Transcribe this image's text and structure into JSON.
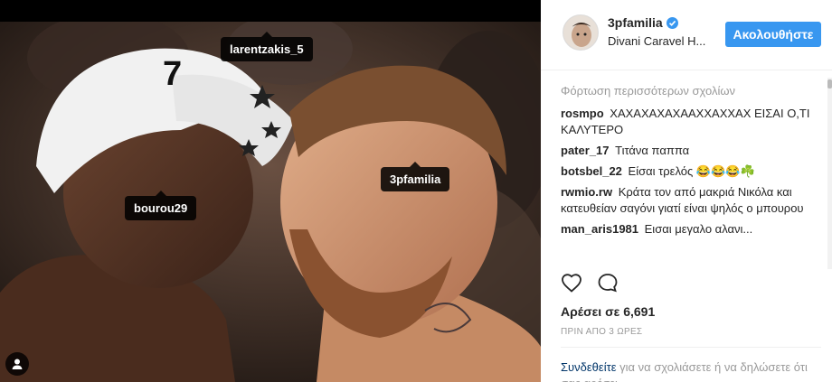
{
  "photo": {
    "tags": {
      "t1": "larentzakis_5",
      "t2": "bourou29",
      "t3": "3pfamilia"
    },
    "cap_text": "7"
  },
  "header": {
    "username": "3pfamilia",
    "location": "Divani Caravel H...",
    "follow_label": "Ακολουθήστε"
  },
  "comments": {
    "load_more": "Φόρτωση περισσότερων σχολίων",
    "items": [
      {
        "author": "rosmpo",
        "text": "ΧΑΧΑΧΑΧΑΧΑΑΧΧΑΧΧΑΧ ΕΙΣΑΙ Ο,ΤΙ ΚΑΛΥΤΕΡΟ"
      },
      {
        "author": "pater_17",
        "text": "Τιτάνα παππα"
      },
      {
        "author": "botsbel_22",
        "text": "Είσαι τρελός 😂😂😂☘️"
      },
      {
        "author": "rwmio.rw",
        "text": "Κράτα τον από μακριά Νικόλα και κατευθείαν σαγόνι γιατί είναι ψηλός ο μπουρου"
      },
      {
        "author": "man_aris1981",
        "text": "Εισαι μεγαλο αλανι..."
      }
    ]
  },
  "likes": "Αρέσει σε 6,691",
  "time": "ΠΡΙΝ ΑΠΟ 3 ΩΡΕΣ",
  "login": {
    "link": "Συνδεθείτε",
    "text": " για να σχολιάσετε ή να δηλώσετε ότι σας αρέσει."
  },
  "icons": {
    "verified": "verified-badge-icon",
    "like": "heart-icon",
    "comment": "comment-bubble-icon",
    "user_tag": "person-icon"
  },
  "colors": {
    "accent": "#3897f0",
    "link": "#003569",
    "muted": "#999999"
  }
}
